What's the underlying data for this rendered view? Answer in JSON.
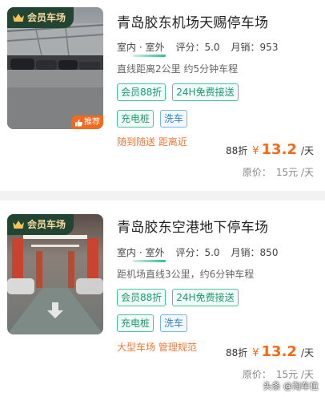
{
  "colors": {
    "accent": "#f26a1b",
    "tag_green": "#1c9a6f",
    "tag_blue": "#2d83c5",
    "vip_bg": "#214532"
  },
  "listings": [
    {
      "vip_badge": "会员车场",
      "recommend_badge": "推荐",
      "title": "青岛胶东机场天赐停车场",
      "type_label": "室内 · 室外",
      "rating": "评分：5.0",
      "sales": "月销：953",
      "distance": "直线距离2公里 约5分钟车程",
      "tags_row1": [
        "会员88折",
        "24H免费接送"
      ],
      "tags_row2": [
        "充电桩",
        "洗车"
      ],
      "features": "随到随送  距离近",
      "discount": "88折",
      "currency": "¥",
      "price": "13.2",
      "unit": "/天",
      "orig_label": "原价：",
      "orig_price": "15元 /天"
    },
    {
      "vip_badge": "会员车场",
      "title": "青岛胶东空港地下停车场",
      "type_label": "室内 · 室外",
      "rating": "评分：5.0",
      "sales": "月销：850",
      "distance": "距机场直线3公里，约6分钟车程",
      "tags_row1": [
        "会员88折",
        "24H免费接送"
      ],
      "tags_row2": [
        "充电桩",
        "洗车"
      ],
      "features": "大型车场 管理规范",
      "discount": "88折",
      "currency": "¥",
      "price": "13.2",
      "unit": "/天",
      "orig_label": "原价：",
      "orig_price": "15元 /天"
    }
  ],
  "watermark": "头条 @淘车位"
}
